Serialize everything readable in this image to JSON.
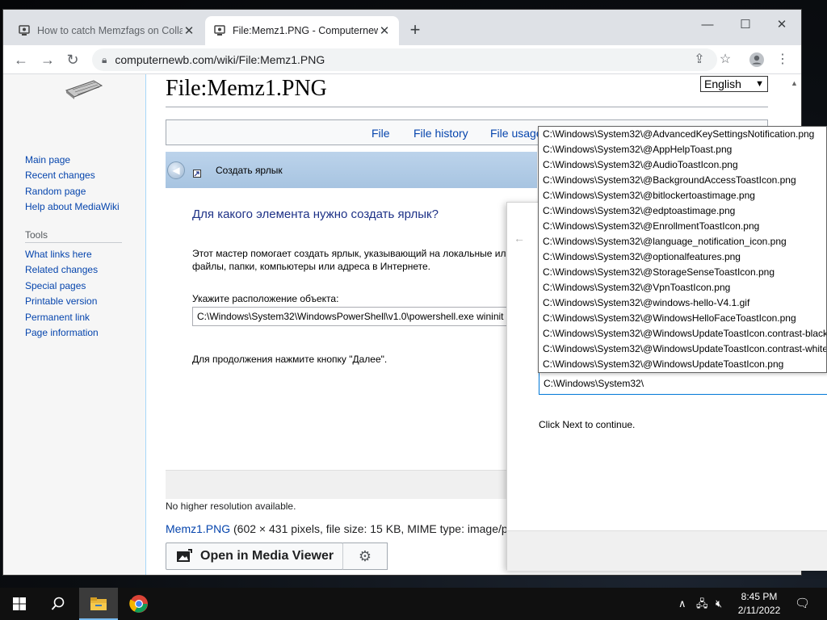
{
  "browser": {
    "tabs": [
      {
        "title": "How to catch Memzfags on Colla",
        "close": "✕"
      },
      {
        "title": "File:Memz1.PNG - Computernew",
        "close": "✕"
      }
    ],
    "new_tab": "+",
    "window_controls": {
      "minimize": "—",
      "maximize": "☐",
      "close": "✕"
    },
    "url": "computernewb.com/wiki/File:Memz1.PNG"
  },
  "wiki": {
    "page_title": "File:Memz1.PNG",
    "language_select": "English",
    "sidebar": {
      "nav": [
        "Main page",
        "Recent changes",
        "Random page",
        "Help about MediaWiki"
      ],
      "tools_heading": "Tools",
      "tools": [
        "What links here",
        "Related changes",
        "Special pages",
        "Printable version",
        "Permanent link",
        "Page information"
      ]
    },
    "file_tabs": [
      "File",
      "File history",
      "File usage"
    ],
    "no_higher_res": "No higher resolution available.",
    "file_link": "Memz1.PNG",
    "file_meta": " (602 × 431 pixels, file size: 15 KB, MIME type: image/p",
    "media_viewer_label": "Open in Media Viewer"
  },
  "wizard_ru": {
    "title": "Создать ярлык",
    "question": "Для какого элемента нужно создать ярлык?",
    "description": "Этот мастер помогает создать ярлык, указывающий на локальные или файлы, папки, компьютеры или адреса в Интернете.",
    "location_label": "Укажите расположение объекта:",
    "location_value": "C:\\Windows\\System32\\WindowsPowerShell\\v1.0\\powershell.exe wininit",
    "continue_text": "Для продолжения нажмите кнопку \"Далее\"."
  },
  "wizard_en": {
    "location_value": "C:\\Windows\\System32\\",
    "continue_text": "Click Next to continue."
  },
  "autocomplete": [
    "C:\\Windows\\System32\\@AdvancedKeySettingsNotification.png",
    "C:\\Windows\\System32\\@AppHelpToast.png",
    "C:\\Windows\\System32\\@AudioToastIcon.png",
    "C:\\Windows\\System32\\@BackgroundAccessToastIcon.png",
    "C:\\Windows\\System32\\@bitlockertoastimage.png",
    "C:\\Windows\\System32\\@edptoastimage.png",
    "C:\\Windows\\System32\\@EnrollmentToastIcon.png",
    "C:\\Windows\\System32\\@language_notification_icon.png",
    "C:\\Windows\\System32\\@optionalfeatures.png",
    "C:\\Windows\\System32\\@StorageSenseToastIcon.png",
    "C:\\Windows\\System32\\@VpnToastIcon.png",
    "C:\\Windows\\System32\\@windows-hello-V4.1.gif",
    "C:\\Windows\\System32\\@WindowsHelloFaceToastIcon.png",
    "C:\\Windows\\System32\\@WindowsUpdateToastIcon.contrast-black",
    "C:\\Windows\\System32\\@WindowsUpdateToastIcon.contrast-white",
    "C:\\Windows\\System32\\@WindowsUpdateToastIcon.png"
  ],
  "taskbar": {
    "time": "8:45 PM",
    "date": "2/11/2022"
  },
  "colors": {
    "link": "#0645ad",
    "wizard_heading": "#1e3287",
    "taskbar": "#101010"
  }
}
